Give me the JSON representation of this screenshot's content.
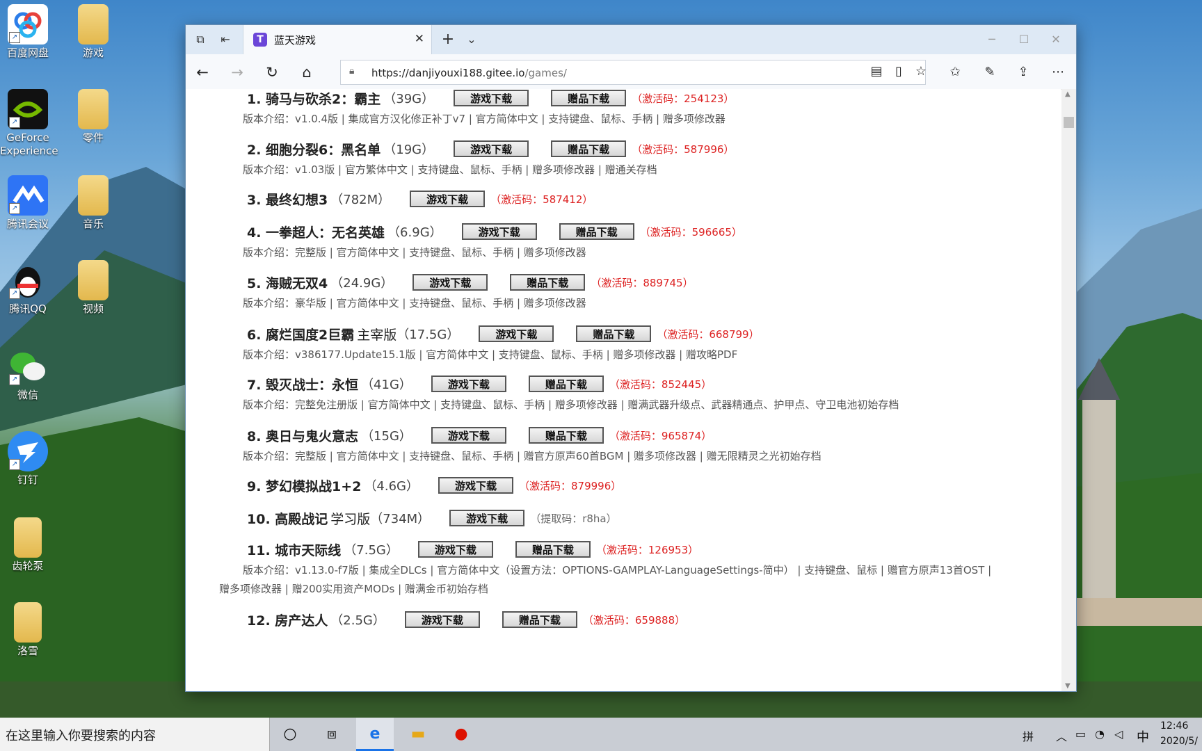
{
  "desktop": {
    "icons": [
      {
        "label": "百度网盘"
      },
      {
        "label": "游戏"
      },
      {
        "label": "GeForce Experience"
      },
      {
        "label": "零件"
      },
      {
        "label": "腾讯会议"
      },
      {
        "label": "音乐"
      },
      {
        "label": "腾讯QQ"
      },
      {
        "label": "视频"
      },
      {
        "label": "微信"
      },
      {
        "label": "钉钉"
      },
      {
        "label": "齿轮泵"
      },
      {
        "label": "洛雪"
      }
    ]
  },
  "browser": {
    "tab_title": "蓝天游戏",
    "favicon_letter": "T",
    "url_host": "https://danjiyouxi188.gitee.io",
    "url_path": "/games/"
  },
  "buttons": {
    "game_download": "游戏下载",
    "gift_download": "赠品下载"
  },
  "games": [
    {
      "name": "1. 骑马与砍杀2：霸主",
      "sub": "",
      "size": "（39G）",
      "code": "（激活码：254123）",
      "desc": "版本介绍：v1.0.4版 | 集成官方汉化修正补丁v7 | 官方简体中文 | 支持键盘、鼠标、手柄 | 赠多项修改器"
    },
    {
      "name": "2. 细胞分裂6：黑名单",
      "sub": "",
      "size": "（19G）",
      "code": "（激活码：587996）",
      "desc": "版本介绍：v1.03版 | 官方繁体中文 | 支持键盘、鼠标、手柄 | 赠多项修改器 | 赠通关存档"
    },
    {
      "name": "3. 最终幻想3",
      "sub": "",
      "size": "（782M）",
      "code": "（激活码：587412）",
      "desc": ""
    },
    {
      "name": "4. 一拳超人：无名英雄",
      "sub": "",
      "size": "（6.9G）",
      "code": "（激活码：596665）",
      "desc": "版本介绍：完整版 | 官方简体中文 | 支持键盘、鼠标、手柄 | 赠多项修改器"
    },
    {
      "name": "5. 海贼无双4",
      "sub": "",
      "size": "（24.9G）",
      "code": "（激活码：889745）",
      "desc": "版本介绍：豪华版 | 官方简体中文 | 支持键盘、鼠标、手柄 | 赠多项修改器"
    },
    {
      "name": "6. 腐烂国度2巨霸",
      "sub": "主宰版",
      "size": "（17.5G）",
      "code": "（激活码：668799）",
      "desc": "版本介绍：v386177.Update15.1版 | 官方简体中文 | 支持键盘、鼠标、手柄 | 赠多项修改器 | 赠攻略PDF"
    },
    {
      "name": "7. 毁灭战士：永恒",
      "sub": "",
      "size": "（41G）",
      "code": "（激活码：852445）",
      "desc": "版本介绍：完整免注册版 | 官方简体中文 | 支持键盘、鼠标、手柄 | 赠多项修改器 | 赠满武器升级点、武器精通点、护甲点、守卫电池初始存档"
    },
    {
      "name": "8. 奥日与鬼火意志",
      "sub": "",
      "size": "（15G）",
      "code": "（激活码：965874）",
      "desc": "版本介绍：完整版 | 官方简体中文 | 支持键盘、鼠标、手柄 | 赠官方原声60首BGM | 赠多项修改器 | 赠无限精灵之光初始存档"
    },
    {
      "name": "9. 梦幻模拟战1+2",
      "sub": "",
      "size": "（4.6G）",
      "code": "（激活码：879996）",
      "desc": ""
    },
    {
      "name": "10. 高殿战记",
      "sub": "学习版",
      "size": "（734M）",
      "code": "（提取码：r8ha）",
      "desc": ""
    },
    {
      "name": "11. 城市天际线",
      "sub": "",
      "size": "（7.5G）",
      "code": "（激活码：126953）",
      "desc": "版本介绍：v1.13.0-f7版 | 集成全DLCs | 官方简体中文（设置方法：OPTIONS-GAMPLAY-LanguageSettings-简中） | 支持键盘、鼠标 | 赠官方原声13首OST |",
      "desc2": "赠多项修改器 | 赠200实用资产MODs | 赠满金币初始存档"
    },
    {
      "name": "12. 房产达人",
      "sub": "",
      "size": "（2.5G）",
      "code": "（激活码：659888）",
      "desc": ""
    }
  ],
  "taskbar": {
    "search_placeholder": "在这里输入你要搜索的内容",
    "ime": "拼",
    "lang": "中",
    "time": "12:46",
    "date": "2020/5/"
  }
}
